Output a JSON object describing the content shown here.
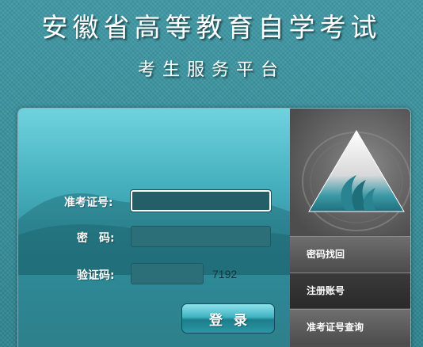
{
  "header": {
    "title": "安徽省高等教育自学考试",
    "subtitle": "考生服务平台"
  },
  "login": {
    "exam_id_label": "准考证号:",
    "exam_id_value": "",
    "password_label": "密　码:",
    "password_value": "",
    "captcha_label": "验证码:",
    "captcha_input_value": "",
    "captcha_code": "7192",
    "submit_label": "登录"
  },
  "side_links": [
    {
      "label": "密码找回"
    },
    {
      "label": "注册账号"
    },
    {
      "label": "准考证号查询"
    }
  ],
  "logo": {
    "icon": "exam-authority-logo-icon"
  },
  "colors": {
    "background": "#3a929e",
    "panel_top": "#6fd3de",
    "panel_bottom": "#2d7f8b",
    "side_dark": "#2a2a2a",
    "side_gray": "#5a5a5a"
  }
}
